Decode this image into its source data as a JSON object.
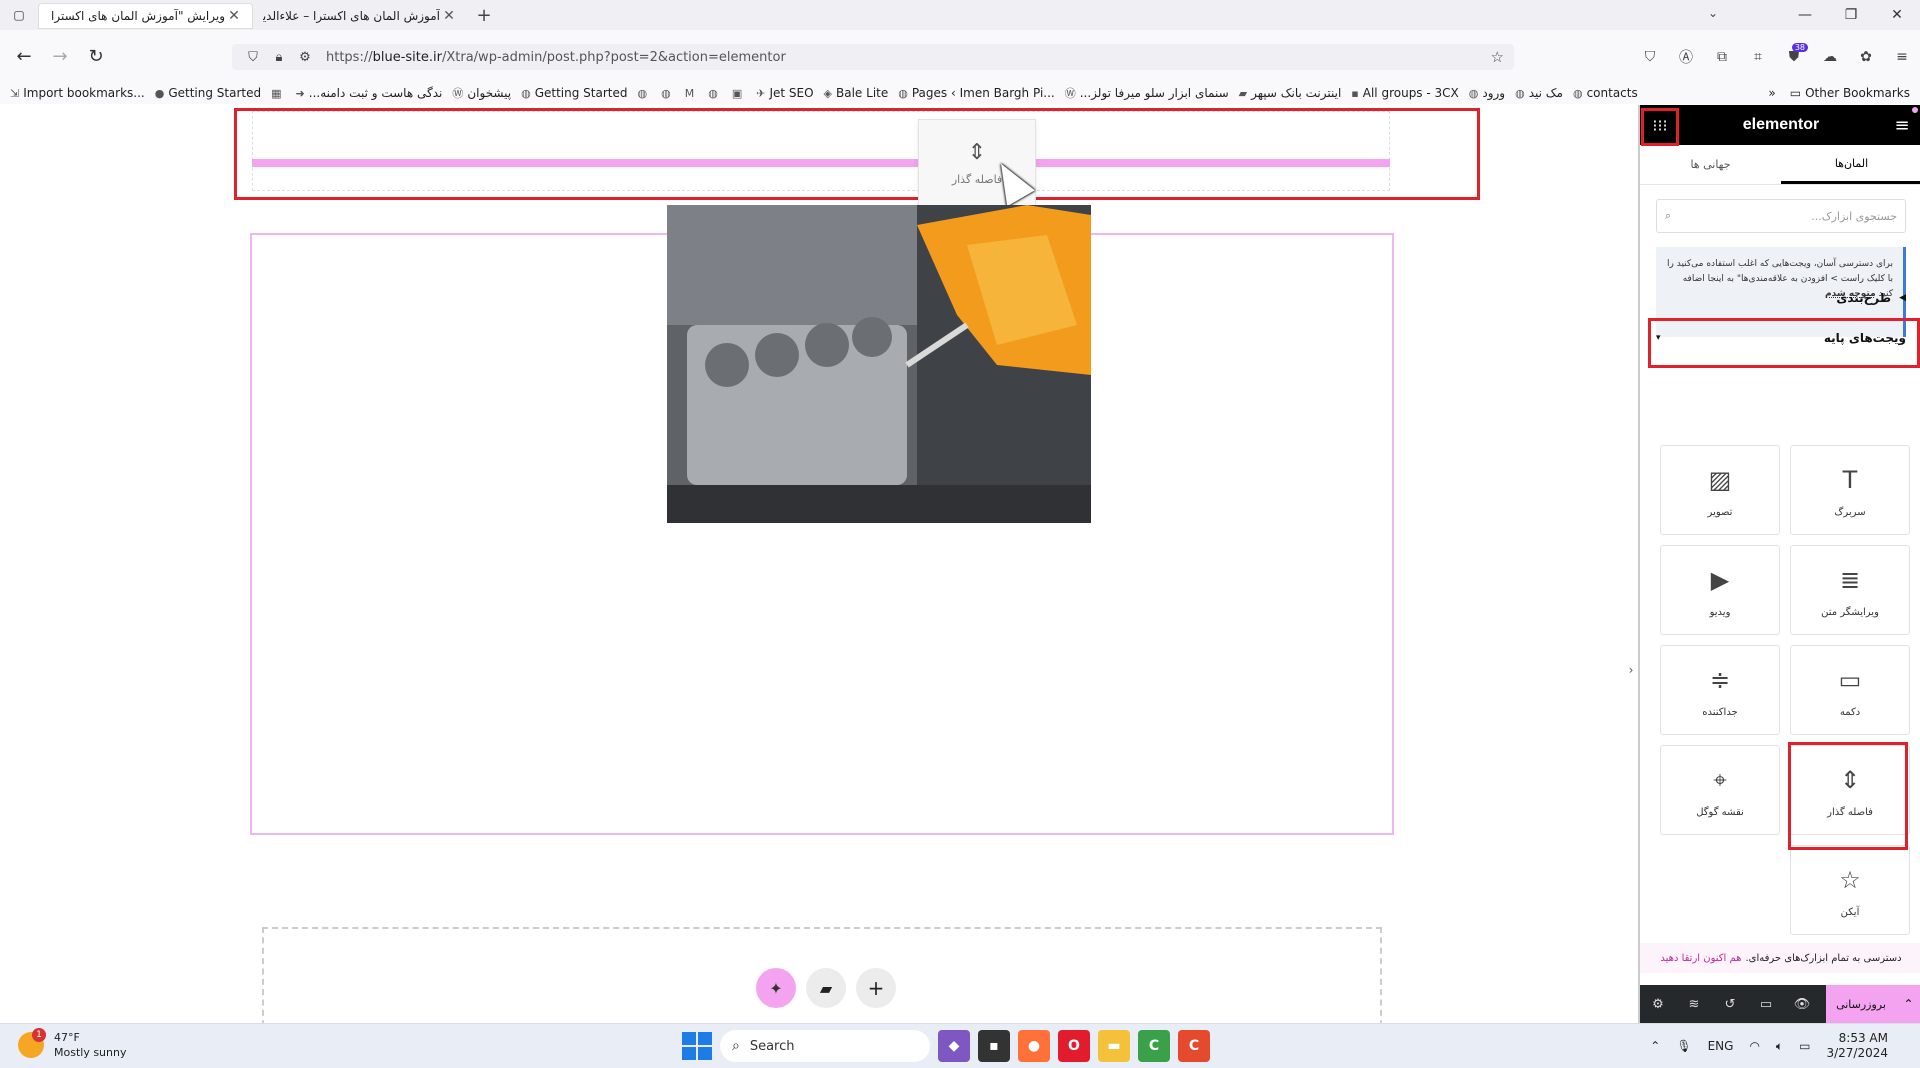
{
  "browser": {
    "tabs": [
      {
        "title": "ویرایش \"آموزش المان های اکسترا -",
        "active": true
      },
      {
        "title": "آموزش المان های اکسترا – علاءالدین",
        "active": false
      }
    ],
    "url_prefix": "https://",
    "url_host": "blue-site.ir",
    "url_path": "/Xtra/wp-admin/post.php?post=2&action=elementor",
    "extension_badge": "38",
    "bookmarks": [
      {
        "label": "Import bookmarks...",
        "icon": "import-icon"
      },
      {
        "label": "Getting Started",
        "icon": "firefox-icon"
      },
      {
        "label": "",
        "icon": "calendar-icon"
      },
      {
        "label": "...ندگی هاست و ثبت دامنه",
        "icon": "arrow-icon"
      },
      {
        "label": "پیشخوان",
        "icon": "wordpress-icon"
      },
      {
        "label": "Getting Started",
        "icon": "globe-icon"
      },
      {
        "label": "",
        "icon": "globe-icon"
      },
      {
        "label": "",
        "icon": "globe-icon"
      },
      {
        "label": "",
        "icon": "gmail-icon"
      },
      {
        "label": "",
        "icon": "globe-icon"
      },
      {
        "label": "",
        "icon": "app-icon"
      },
      {
        "label": "Jet SEO",
        "icon": "rocket-icon"
      },
      {
        "label": "Bale Lite",
        "icon": "bale-icon"
      },
      {
        "label": "Pages ‹ Imen Bargh Pi...",
        "icon": "globe-icon"
      },
      {
        "label": "...سنمای ابزار سلو میرفا تولز",
        "icon": "wordpress-icon"
      },
      {
        "label": "اینترنت بانک سپهر",
        "icon": "bank-icon"
      },
      {
        "label": "All groups - 3CX",
        "icon": "3cx-icon"
      },
      {
        "label": "ورود",
        "icon": "globe-icon"
      },
      {
        "label": "مک نید",
        "icon": "globe-icon"
      },
      {
        "label": "contacts",
        "icon": "globe-icon"
      }
    ],
    "other_bookmarks": "Other Bookmarks"
  },
  "canvas": {
    "drag_ghost_label": "فاصله گذار"
  },
  "panel": {
    "logo": "elementor",
    "tabs": [
      {
        "label": "المان‌ها",
        "active": true
      },
      {
        "label": "جهانی ها",
        "active": false
      }
    ],
    "search_placeholder": "جستجوی ابزارک...",
    "notice_text": "برای دسترسی آسان، ویجت‌هایی که اغلب استفاده می‌کنید را با کلیک راست > افزودن به علاقه‌مندی‌ها\" به اینجا اضافه کنید",
    "notice_link": "متوجه شدم",
    "categories": {
      "layout": "طرح‌بندی",
      "basic": "ویجت‌های پایه"
    },
    "widgets": [
      {
        "label": "سربرگ",
        "icon": "heading-icon"
      },
      {
        "label": "تصویر",
        "icon": "image-icon"
      },
      {
        "label": "ویرایشگر متن",
        "icon": "text-editor-icon"
      },
      {
        "label": "ویدیو",
        "icon": "video-icon"
      },
      {
        "label": "دکمه",
        "icon": "button-icon"
      },
      {
        "label": "جداکننده",
        "icon": "divider-icon"
      },
      {
        "label": "فاصله گذار",
        "icon": "spacer-icon"
      },
      {
        "label": "نقشه گوگل",
        "icon": "map-icon"
      },
      {
        "label": "آیکن",
        "icon": "star-icon"
      }
    ],
    "pro_text": "دسترسی به تمام ابزارک‌های حرفه‌ای.",
    "pro_link": "هم اکنون ارتقا دهید",
    "publish_label": "بروزرسانی"
  },
  "taskbar": {
    "weather_temp": "47°F",
    "weather_desc": "Mostly sunny",
    "weather_badge": "1",
    "search_label": "Search",
    "language": "ENG",
    "time": "8:53 AM",
    "date": "3/27/2024"
  },
  "colors": {
    "highlight_red": "#e0202a",
    "elementor_pink": "#f3a3ef",
    "panel_dark": "#26292c"
  }
}
